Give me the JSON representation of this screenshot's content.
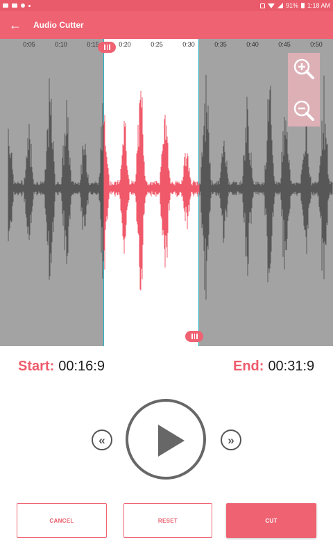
{
  "status_bar": {
    "battery": "91%",
    "time": "1:18 AM",
    "left_icons": [
      "video-icon",
      "message-icon",
      "shield-icon",
      "dot-icon"
    ],
    "right_icons": [
      "cast-icon",
      "wifi-icon",
      "signal-icon",
      "battery-icon"
    ]
  },
  "app_bar": {
    "back_icon": "arrow-left-icon",
    "title": "Audio Cutter"
  },
  "waveform": {
    "tick_labels": [
      "0:05",
      "0:10",
      "0:15",
      "0:20",
      "0:25",
      "0:30",
      "0:35",
      "0:40",
      "0:45",
      "0:50"
    ],
    "selection_start_label": "0:16.9",
    "selection_end_label": "0:31.9",
    "zoom_in_icon": "zoom-in-icon",
    "zoom_out_icon": "zoom-out-icon"
  },
  "times": {
    "start_label": "Start:",
    "start_value": "00:16:9",
    "end_label": "End:",
    "end_value": "00:31:9"
  },
  "controls": {
    "rewind_icon": "rewind-icon",
    "rewind_glyph": "«",
    "play_icon": "play-icon",
    "forward_icon": "fast-forward-icon",
    "forward_glyph": "»"
  },
  "buttons": {
    "cancel": "CANCEL",
    "reset": "RESET",
    "cut": "CUT"
  },
  "colors": {
    "accent": "#ef6272",
    "selection_wave": "#f0596a",
    "unselected_wave": "#575757",
    "wave_background": "#a3a3a3"
  }
}
